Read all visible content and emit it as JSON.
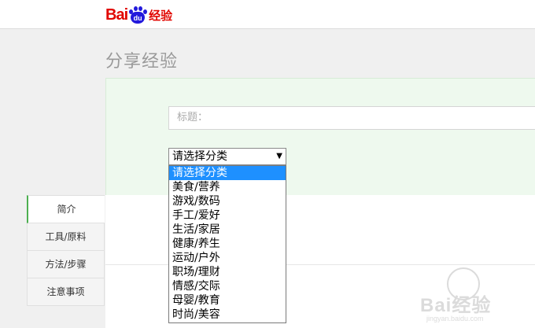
{
  "header": {
    "logo": {
      "bai": "Bai",
      "du": "du",
      "jingyan": "经验"
    }
  },
  "page_title": "分享经验",
  "form": {
    "title_placeholder": "标题：",
    "category_select": {
      "selected": "请选择分类",
      "options": [
        "请选择分类",
        "美食/营养",
        "游戏/数码",
        "手工/爱好",
        "生活/家居",
        "健康/养生",
        "运动/户外",
        "职场/理财",
        "情感/交际",
        "母婴/教育",
        "时尚/美容"
      ]
    }
  },
  "tabs": [
    "简介",
    "工具/原料",
    "方法/步骤",
    "注意事项"
  ],
  "watermark": {
    "text": "Bai经验",
    "url": "jingyan.baidu.com"
  },
  "colors": {
    "brand_red": "#e10601",
    "brand_blue": "#2319dc",
    "accent_green": "#4caf50",
    "selected_option": "#1e90ff"
  }
}
